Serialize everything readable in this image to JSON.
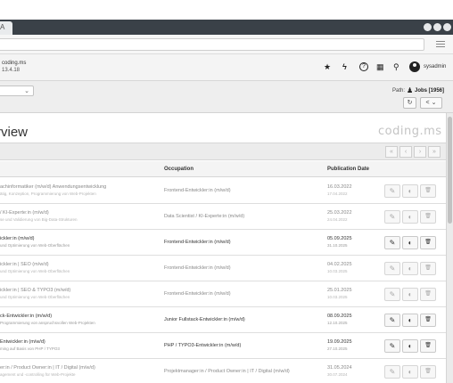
{
  "browser": {
    "tab_glyph": "A",
    "menu_icon": "hamburger-menu-icon"
  },
  "module_header": {
    "site_name": "coding.ms",
    "version": "13.4.18",
    "icons": [
      "star-icon",
      "bolt-icon",
      "help-icon",
      "grid-icon",
      "search-icon",
      "user-avatar-icon"
    ],
    "icon_glyphs": [
      "★",
      "ϟ",
      "?",
      "▦",
      "⚲"
    ],
    "username": "sysadmin"
  },
  "doc_header": {
    "select_caret": "⌄",
    "path_label": "Path:",
    "path_title": "Jobs [1956]",
    "refresh_glyph": "↻",
    "share_glyph": "< ⌄"
  },
  "page": {
    "title": "rview",
    "brand": "coding.ms"
  },
  "pagination": {
    "buttons": [
      "«",
      "‹",
      "›",
      "»"
    ]
  },
  "table": {
    "headers": {
      "occupation": "Occupation",
      "publication_date": "Publication Date"
    },
    "rows": [
      {
        "title": "achinformatiker (m/w/d) Anwendungsentwicklung",
        "subtitle": "ätig, Konzeption, Programmierung von Web-Projekten",
        "occupation": "Frontend-Entwickler:in (m/w/d)",
        "date": "16.03.2022",
        "date_sub": "17.04.2022",
        "hidden": true
      },
      {
        "title": "/ KI-Experte:in (m/w/d)",
        "subtitle": "se und Validierung von Big-Data-Strukturen",
        "occupation": "Data Scientist / KI-Experte:in (m/w/d)",
        "date": "25.03.2022",
        "date_sub": "24.04.2022",
        "hidden": true
      },
      {
        "title": "ickler:in (m/w/d)",
        "subtitle": "und Optimierung von Web-Oberflächen",
        "occupation": "Frontend-Entwickler:in (m/w/d)",
        "date": "05.09.2025",
        "date_sub": "31.10.2025",
        "hidden": false
      },
      {
        "title": "ickler:in | SEO (m/w/d)",
        "subtitle": "und Optimierung von Web-Oberflächen",
        "occupation": "Frontend-Entwickler:in (m/w/d)",
        "date": "04.02.2025",
        "date_sub": "10.03.2025",
        "hidden": true
      },
      {
        "title": "ickler:in | SEO & TYPO3 (m/w/d)",
        "subtitle": "und Optimierung von Web-Oberflächen",
        "occupation": "Frontend-Entwickler:in (m/w/d)",
        "date": "25.01.2025",
        "date_sub": "10.03.2025",
        "hidden": true
      },
      {
        "title": "ck-Entwickler:in (m/w/d)",
        "subtitle": "Programmierung von anspruchsvollen Web-Projekten",
        "occupation": "Junior Fullstack-Entwickler:in (m/w/d)",
        "date": "08.09.2025",
        "date_sub": "12.10.2025",
        "hidden": false
      },
      {
        "title": "Entwickler:in (m/w/d)",
        "subtitle": "ming auf Basis von PHP / TYPO3",
        "occupation": "PHP / TYPO3-Entwickler:in (m/w/d)",
        "date": "19.09.2025",
        "date_sub": "27.10.2025",
        "hidden": false
      },
      {
        "title": "er:in / Product Owner:in | IT / Digital (m/w/d)",
        "subtitle": "agement und -controlling für Web-Projekte",
        "occupation": "Projektmanager:in / Product Owner:in | IT / Digital (m/w/d)",
        "date": "31.05.2024",
        "date_sub": "30.07.2024",
        "hidden": true
      }
    ],
    "action_icons": [
      "edit-icon",
      "visibility-toggle-icon",
      "delete-icon"
    ],
    "action_glyphs": {
      "edit": "✎",
      "toggle": "◐",
      "delete": "🗑"
    }
  }
}
